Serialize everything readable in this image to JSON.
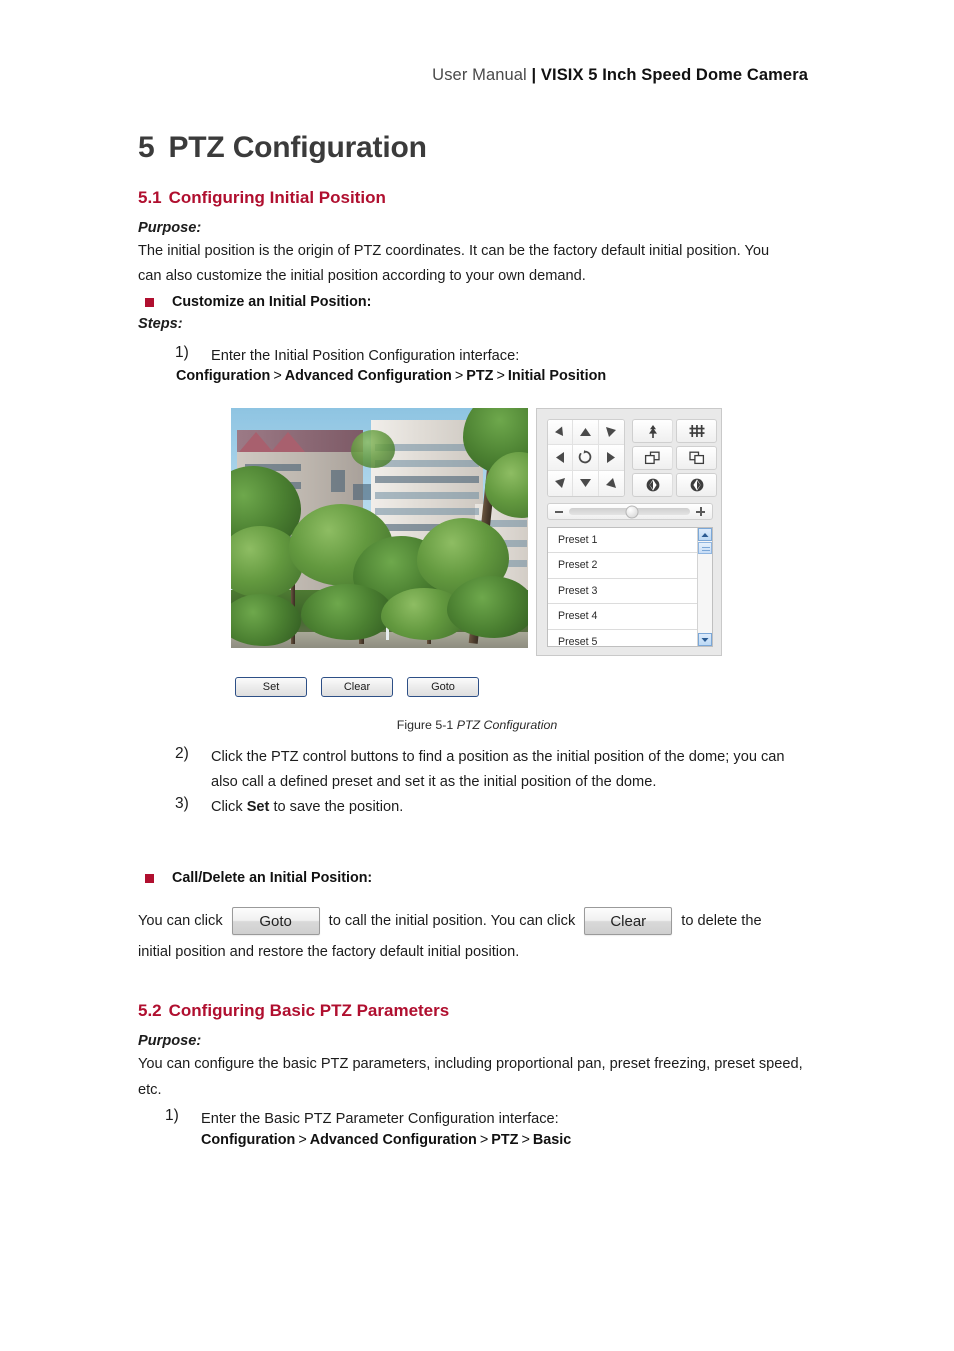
{
  "header": {
    "light": "User Manual ",
    "bold": "| VISIX 5 Inch Speed Dome Camera"
  },
  "chapter": {
    "number": "5",
    "title": "PTZ Configuration"
  },
  "section_51": {
    "number": "5.1",
    "title": "Configuring Initial Position",
    "purpose_label": "Purpose:",
    "purpose_line1": "The initial position is the origin of PTZ coordinates. It can be the factory default initial position. You",
    "purpose_line2": "can also customize the initial position according to your own demand.",
    "bullet1": "Customize an Initial Position:",
    "steps_label": "Steps:",
    "step1_num": "1)",
    "step1_text": "Enter the Initial Position Configuration interface:",
    "step1_crumb_1": "Configuration",
    "step1_crumb_2": "Advanced Configuration",
    "step1_crumb_3": "PTZ",
    "step1_crumb_4": "Initial Position",
    "crumb_sep": ">",
    "step2_num": "2)",
    "step2_line1": "Click the PTZ control buttons to find a position as the initial position of the dome; you can",
    "step2_line2": "also call a defined preset and set it as the initial position of the dome.",
    "step3_num": "3)",
    "step3_pre": "Click ",
    "step3_bold": "Set",
    "step3_post": " to save the position.",
    "bullet2": "Call/Delete an Initial Position:",
    "call_pre": "You can click",
    "call_btn_goto": "Goto",
    "call_mid": "to call the initial position. You can click",
    "call_btn_clear": "Clear",
    "call_post": "to delete the",
    "call_line2": "initial position and restore the factory default initial position."
  },
  "figure": {
    "caption_label": "Figure 5-1",
    "caption_title": "PTZ Configuration"
  },
  "ptz": {
    "dpad": [
      {
        "name": "pan-down-left",
        "glyph": "down-left"
      },
      {
        "name": "tilt-up",
        "glyph": "up"
      },
      {
        "name": "pan-up-left",
        "glyph": "up-left"
      },
      {
        "name": "pan-left",
        "glyph": "left"
      },
      {
        "name": "auto-scan",
        "glyph": "refresh"
      },
      {
        "name": "pan-right",
        "glyph": "right"
      },
      {
        "name": "pan-up-right",
        "glyph": "up-right"
      },
      {
        "name": "tilt-down",
        "glyph": "down"
      },
      {
        "name": "pan-down-right",
        "glyph": "down-right"
      }
    ],
    "functions": [
      {
        "name": "zoom-in",
        "glyph": "tree"
      },
      {
        "name": "zoom-out",
        "glyph": "fence"
      },
      {
        "name": "focus-near",
        "glyph": "squares-left"
      },
      {
        "name": "focus-far",
        "glyph": "squares-right"
      },
      {
        "name": "iris-open",
        "glyph": "circle-left"
      },
      {
        "name": "iris-close",
        "glyph": "circle-right"
      }
    ],
    "slider": {
      "minus_label": "-",
      "plus_label": "+",
      "value_percent": 52
    },
    "presets": [
      "Preset 1",
      "Preset 2",
      "Preset 3",
      "Preset 4",
      "Preset 5"
    ],
    "buttons": [
      "Set",
      "Clear",
      "Goto"
    ]
  },
  "section_52": {
    "number": "5.2",
    "title": "Configuring Basic PTZ Parameters",
    "purpose_label": "Purpose:",
    "purpose_line1": "You can configure the basic PTZ parameters, including proportional pan, preset freezing, preset speed,",
    "purpose_line2": "etc.",
    "step1_num": "1)",
    "step1_text": "Enter the Basic PTZ Parameter Configuration interface:",
    "step1_crumb_1": "Configuration",
    "step1_crumb_2": "Advanced Configuration",
    "step1_crumb_3": "PTZ",
    "step1_crumb_4": "Basic"
  },
  "colors": {
    "accent_red": "#b00f2f",
    "heading_gray": "#3b3b3b",
    "body": "#1c1c1c"
  }
}
